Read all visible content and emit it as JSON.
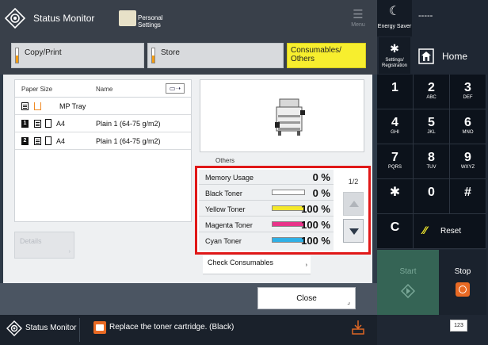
{
  "header": {
    "title": "Status Monitor",
    "personal_settings": "Personal Settings",
    "menu_label": "Menu"
  },
  "right": {
    "energy_saver": "Energy Saver",
    "dash": "-----",
    "settings_registration": "Settings/ Registration",
    "home": "Home",
    "keys": [
      {
        "num": "1",
        "sub": ""
      },
      {
        "num": "2",
        "sub": "ABC"
      },
      {
        "num": "3",
        "sub": "DEF"
      },
      {
        "num": "4",
        "sub": "GHI"
      },
      {
        "num": "5",
        "sub": "JKL"
      },
      {
        "num": "6",
        "sub": "MNO"
      },
      {
        "num": "7",
        "sub": "PQRS"
      },
      {
        "num": "8",
        "sub": "TUV"
      },
      {
        "num": "9",
        "sub": "WXYZ"
      },
      {
        "num": "✱",
        "sub": ""
      },
      {
        "num": "0",
        "sub": ""
      },
      {
        "num": "#",
        "sub": ""
      }
    ],
    "c_key": "C",
    "reset": "Reset",
    "start": "Start",
    "stop": "Stop",
    "keyboard": "123"
  },
  "tabs": [
    {
      "label": "Copy/Print",
      "active": false
    },
    {
      "label": "Store",
      "active": false
    },
    {
      "label": "Consumables/ Others",
      "active": true
    }
  ],
  "paper_list": {
    "headers": {
      "paper_size": "Paper Size",
      "name": "Name"
    },
    "rows": [
      {
        "num": "",
        "tray": "MP Tray",
        "size": "",
        "name": ""
      },
      {
        "num": "1",
        "tray": "",
        "size": "A4",
        "name": "Plain 1 (64-75 g/m2)"
      },
      {
        "num": "2",
        "tray": "",
        "size": "A4",
        "name": "Plain 1 (64-75 g/m2)"
      }
    ]
  },
  "details": "Details",
  "others_label": "Others",
  "consumables": {
    "page": "1/2",
    "rows": [
      {
        "label": "Memory Usage",
        "value": "0 %",
        "level": 0,
        "color": "",
        "bar": false
      },
      {
        "label": "Black Toner",
        "value": "0 %",
        "level": 0,
        "color": "#222222",
        "bar": true
      },
      {
        "label": "Yellow Toner",
        "value": "100 %",
        "level": 100,
        "color": "#f4e82a",
        "bar": true
      },
      {
        "label": "Magenta Toner",
        "value": "100 %",
        "level": 100,
        "color": "#e8348a",
        "bar": true
      },
      {
        "label": "Cyan Toner",
        "value": "100 %",
        "level": 100,
        "color": "#2fb0e6",
        "bar": true
      }
    ]
  },
  "check_consumables": "Check Consumables",
  "close": "Close",
  "statusbar": {
    "title": "Status Monitor",
    "message": "Replace the toner cartridge. (Black)"
  },
  "colors": {
    "highlight_border": "#e01818",
    "active_tab": "#f7ee2e",
    "start": "#356455",
    "stop_icon": "#e86a24"
  }
}
